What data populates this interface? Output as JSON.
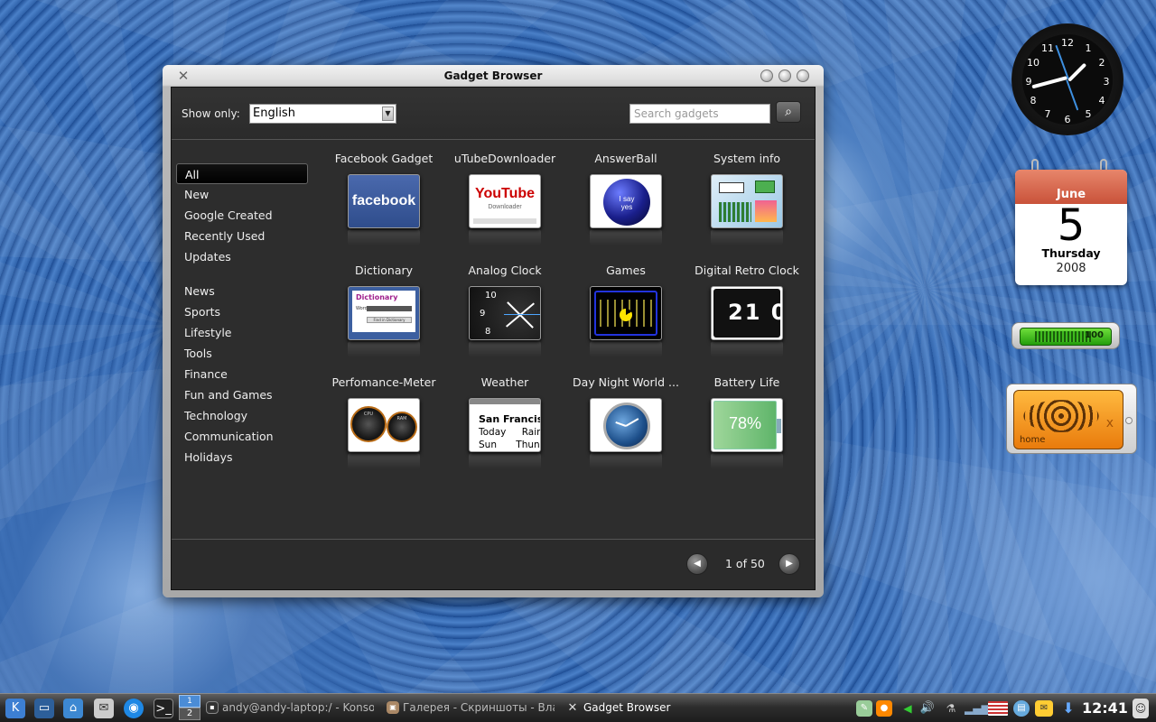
{
  "window": {
    "title": "Gadget Browser",
    "show_only_label": "Show only:",
    "language": "English",
    "search_placeholder": "Search gadgets"
  },
  "sidebar": {
    "items": [
      "All",
      "New",
      "Google Created",
      "Recently Used",
      "Updates",
      "News",
      "Sports",
      "Lifestyle",
      "Tools",
      "Finance",
      "Fun and Games",
      "Technology",
      "Communication",
      "Holidays"
    ],
    "selected": "All"
  },
  "gadgets": [
    {
      "label": "Facebook Gadget",
      "thumb_text": "facebook"
    },
    {
      "label": "uTubeDownloader",
      "thumb_text": "YouTube",
      "thumb_sub": "Downloader"
    },
    {
      "label": "AnswerBall",
      "thumb_text": "I say yes"
    },
    {
      "label": "System info",
      "thumb_text": ""
    },
    {
      "label": "Dictionary",
      "thumb_text": "Dictionary",
      "thumb_sub": "Word",
      "thumb_btn": "Find in Dictionary"
    },
    {
      "label": "Analog Clock",
      "thumb_text": "10",
      "thumb_sub": "9",
      "thumb_extra": "8"
    },
    {
      "label": "Games",
      "thumb_text": ""
    },
    {
      "label": "Digital Retro Clock",
      "thumb_text": "21 0"
    },
    {
      "label": "Perfomance-Meter",
      "thumb_text": "CPU",
      "thumb_sub": "RAM"
    },
    {
      "label": "Weather",
      "thumb_text": "San Francisco",
      "thumb_sub": "Today Rain,",
      "thumb_extra": "Sun Thun"
    },
    {
      "label": "Day Night World ...",
      "thumb_text": ""
    },
    {
      "label": "Battery Life",
      "thumb_text": "78%"
    }
  ],
  "pagination": {
    "text": "1 of 50"
  },
  "clock_widget": {
    "numbers": [
      "12",
      "1",
      "2",
      "3",
      "4",
      "5",
      "6",
      "7",
      "8",
      "9",
      "10",
      "11"
    ]
  },
  "calendar_widget": {
    "month": "June",
    "day": "5",
    "weekday": "Thursday",
    "year": "2008"
  },
  "battery_widget": {
    "value": "100",
    "level": 1.0
  },
  "audio_widget": {
    "label": "home",
    "close": "x"
  },
  "taskbar": {
    "pager": {
      "desk1": "1",
      "desk2": "2"
    },
    "tasks": [
      "andy@andy-laptop:/ - Konso",
      "Галерея - Скриншоты - Вла",
      "Gadget Browser"
    ],
    "clock": "12:41"
  },
  "colors": {
    "accent": "#4b8cd6",
    "window_body": "#2d2d2d",
    "calendar_header": "#d56245",
    "battery_green": "#3ebb1e",
    "audio_orange": "#f39a22"
  }
}
